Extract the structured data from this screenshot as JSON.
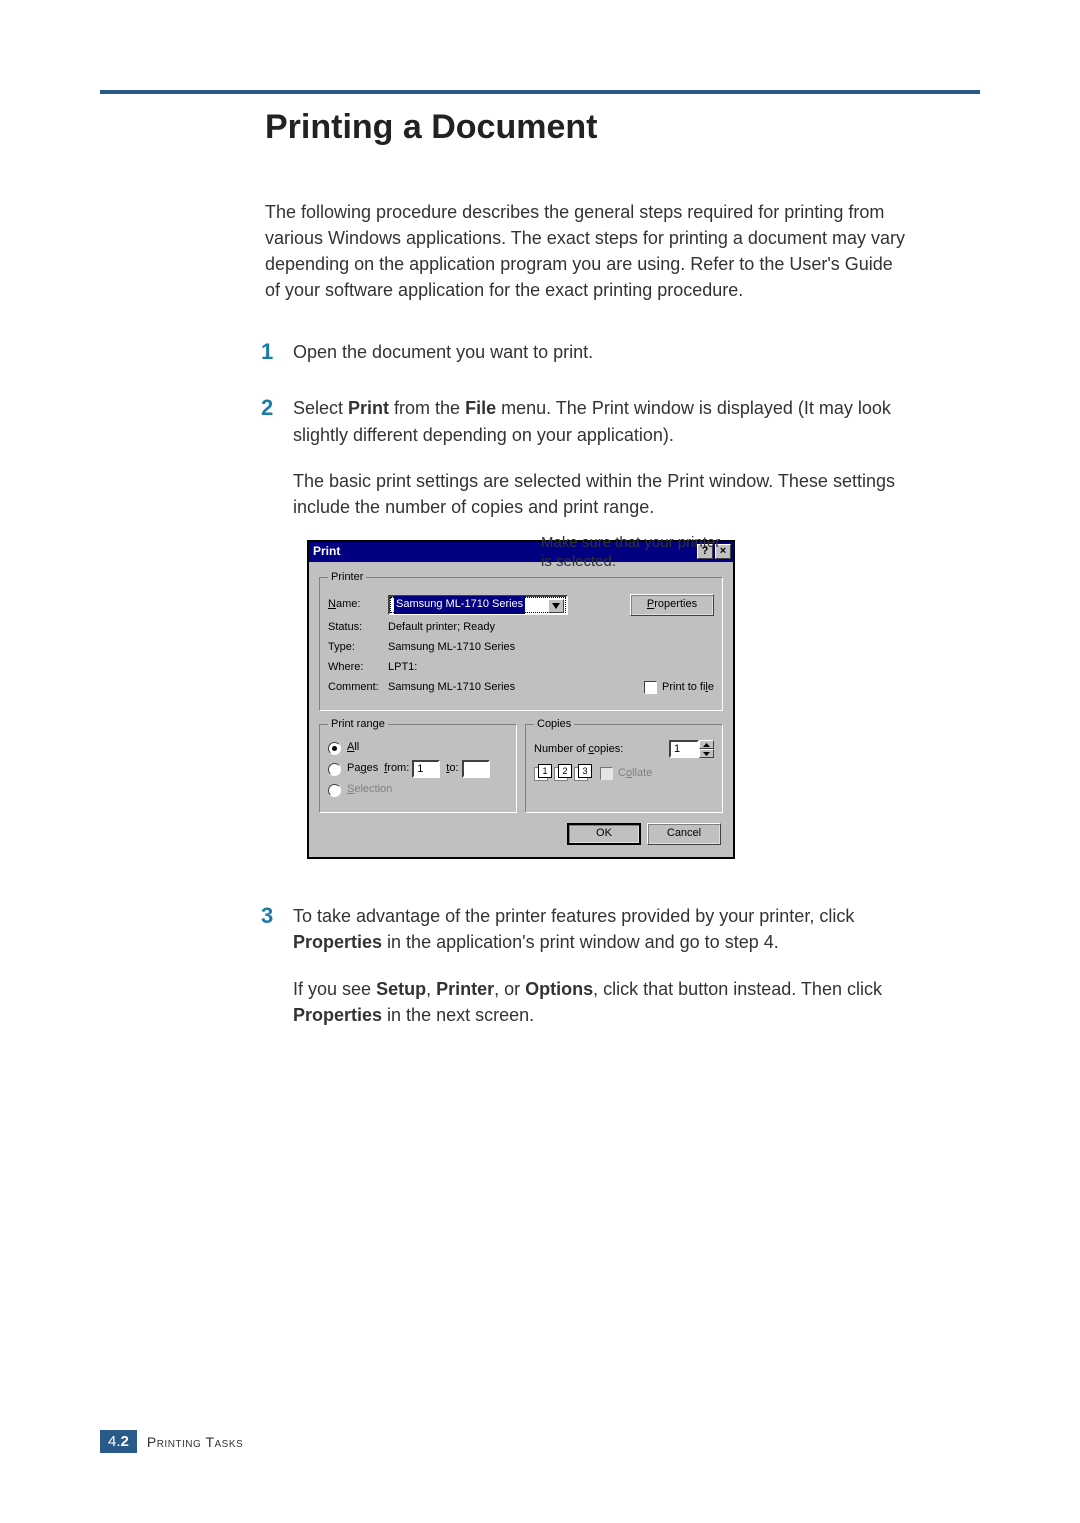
{
  "section_title": "Printing a Document",
  "intro": "The following procedure describes the general steps required for printing from various Windows applications. The exact steps for printing a document may vary depending on the application program you are using. Refer to the User's Guide of your software application for the exact printing procedure.",
  "steps": {
    "s1": {
      "num": "1",
      "text": "Open the document you want to print."
    },
    "s2": {
      "num": "2",
      "text_a": "Select ",
      "bold_a": "Print",
      "text_b": " from the ",
      "bold_b": "File",
      "text_c": " menu. The Print window is displayed (It may look slightly different depending on your application).",
      "para2": "The basic print settings are selected within the Print window. These settings include the number of copies and print range."
    },
    "s3": {
      "num": "3",
      "text_a": "To take advantage of the printer features provided by your printer, click ",
      "bold_a": "Properties",
      "text_b": " in the application's print window and go to step 4.",
      "para2_a": "If you see ",
      "b_setup": "Setup",
      "sep1": ", ",
      "b_printer": "Printer",
      "sep2": ", or ",
      "b_options": "Options",
      "para2_b": ", click that button instead. Then click ",
      "b_props": "Properties",
      "para2_c": " in the next screen."
    }
  },
  "callout": "Make sure that your printer is selected.",
  "dialog": {
    "title": "Print",
    "help_btn": "?",
    "close_btn": "×",
    "printer_group": "Printer",
    "name_label_u": "N",
    "name_label_rest": "ame:",
    "name_value": "Samsung ML-1710 Series",
    "properties_u": "P",
    "properties_rest": "roperties",
    "status_label": "Status:",
    "status_value": "Default printer; Ready",
    "type_label": "Type:",
    "type_value": "Samsung ML-1710 Series",
    "where_label": "Where:",
    "where_value": "LPT1:",
    "comment_label": "Comment:",
    "comment_value": "Samsung ML-1710 Series",
    "print_to_file_rest": "Print to fi",
    "print_to_file_u": "l",
    "print_to_file_end": "e",
    "print_range_group": "Print range",
    "all_u": "A",
    "all_rest": "ll",
    "pages_label_rest": "Pa",
    "pages_label_u": "g",
    "pages_label_end": "es",
    "from_u": "f",
    "from_rest": "rom:",
    "from_value": "1",
    "to_u": "t",
    "to_rest": "o:",
    "selection_u": "S",
    "selection_rest": "election",
    "copies_group": "Copies",
    "num_copies_a": "Number of ",
    "num_copies_u": "c",
    "num_copies_b": "opies:",
    "num_copies_value": "1",
    "collate_label_a": "C",
    "collate_u": "o",
    "collate_label_b": "llate",
    "collate_icons": [
      "1",
      "2",
      "3"
    ],
    "ok": "OK",
    "cancel": "Cancel"
  },
  "footer": {
    "chapter": "4.",
    "page": "2",
    "label": "Printing Tasks"
  }
}
